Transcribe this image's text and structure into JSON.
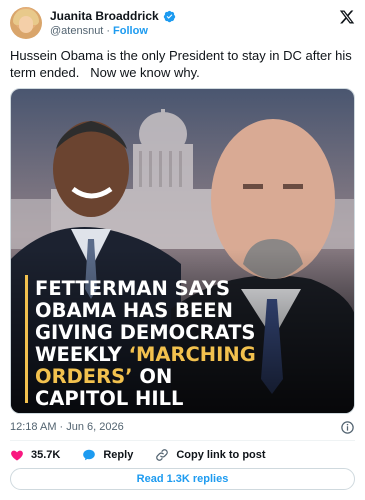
{
  "author": {
    "display_name": "Juanita Broaddrick",
    "handle": "@atensnut",
    "separator": "·",
    "follow_label": "Follow"
  },
  "tweet": {
    "text": "Hussein Obama is the only President to stay in DC after his term ended.   Now we know why."
  },
  "media": {
    "headline_lines": [
      {
        "text": "FETTERMAN  SAYS",
        "highlight": ""
      },
      {
        "text": "OBAMA HAS BEEN",
        "highlight": ""
      },
      {
        "text": "GIVING DEMOCRATS",
        "highlight": ""
      },
      {
        "text": "WEEKLY ",
        "highlight": "‘MARCHING"
      },
      {
        "text": "",
        "highlight": "ORDERS’",
        "rest": " ON"
      },
      {
        "text": "CAPITOL HILL",
        "highlight": ""
      }
    ],
    "headline_color": "#ffffff",
    "highlight_color": "#f2c14e",
    "accent_bar_color": "#f2c14e"
  },
  "meta": {
    "timestamp": "12:18 AM · Jun 6, 2026"
  },
  "actions": {
    "likes": "35.7K",
    "reply_label": "Reply",
    "copy_label": "Copy link to post",
    "read_replies_label": "Read 1.3K replies"
  },
  "colors": {
    "accent": "#1d9bf0",
    "like": "#f91880",
    "text": "#0f1419",
    "muted": "#536471"
  }
}
